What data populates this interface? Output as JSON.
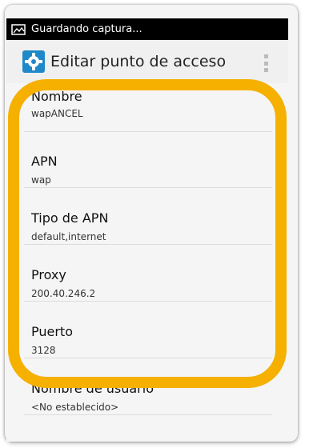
{
  "status_bar": {
    "notification": "Guardando captura...",
    "icon": "screenshot-icon"
  },
  "action_bar": {
    "title": "Editar punto de acceso",
    "app_icon": "settings-gear-icon",
    "overflow_icon": "overflow-menu-icon"
  },
  "apn_fields": [
    {
      "label": "Nombre",
      "value": "wapANCEL"
    },
    {
      "label": "APN",
      "value": "wap"
    },
    {
      "label": "Tipo de APN",
      "value": "default,internet"
    },
    {
      "label": "Proxy",
      "value": "200.40.246.2"
    },
    {
      "label": "Puerto",
      "value": "3128"
    },
    {
      "label": "Nombre de usuario",
      "value": "<No establecido>"
    }
  ],
  "colors": {
    "highlight": "#f5b000",
    "status_bar": "#000000",
    "app_icon": "#1e88c9"
  }
}
